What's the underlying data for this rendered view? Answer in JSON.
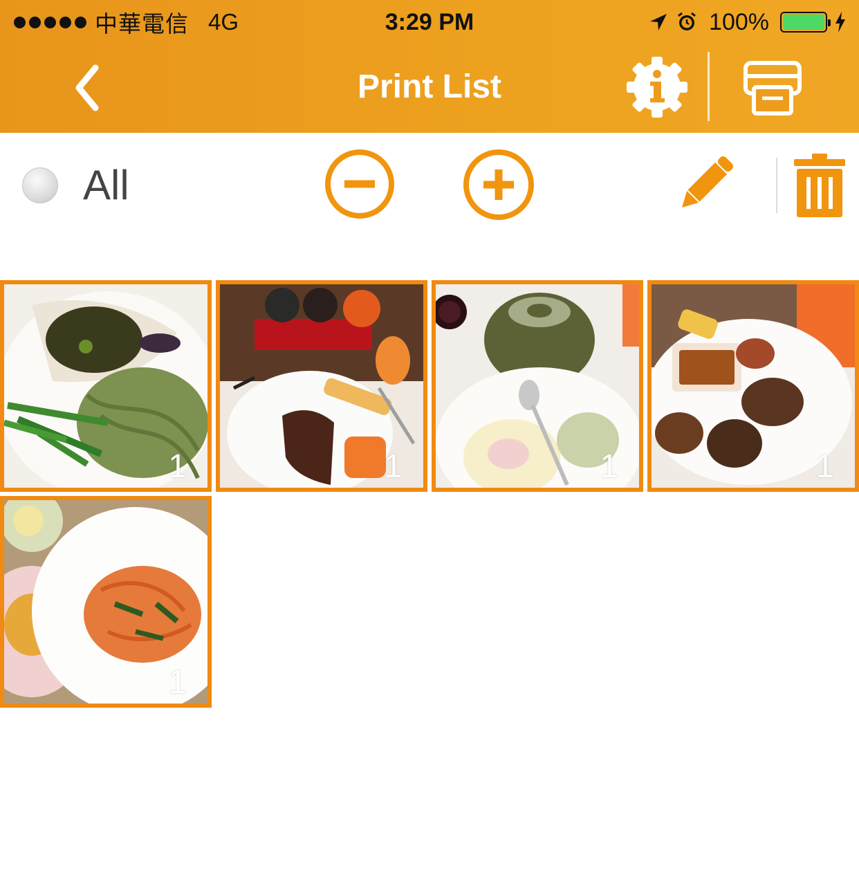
{
  "status_bar": {
    "carrier": "中華電信",
    "network": "4G",
    "time": "3:29 PM",
    "battery": "100%"
  },
  "nav": {
    "title": "Print List",
    "icons": [
      "back-chevron-icon",
      "info-gear-icon",
      "printer-icon"
    ]
  },
  "toolbar": {
    "select_all_label": "All",
    "icons": [
      "minus-circle-icon",
      "plus-circle-icon",
      "pencil-icon",
      "trash-icon"
    ]
  },
  "photos": [
    {
      "subject": "pasta-and-vegetable-plate",
      "copies": "1"
    },
    {
      "subject": "steak-and-sushi-plate",
      "copies": "1"
    },
    {
      "subject": "teapot-and-custard",
      "copies": "1"
    },
    {
      "subject": "grilled-chicken-plate",
      "copies": "1"
    },
    {
      "subject": "tomato-spaghetti-plate",
      "copies": "1"
    }
  ],
  "colors": {
    "accent": "#ed9c1e",
    "thumb_border": "#f08a12",
    "battery_fill": "#4cd964"
  }
}
